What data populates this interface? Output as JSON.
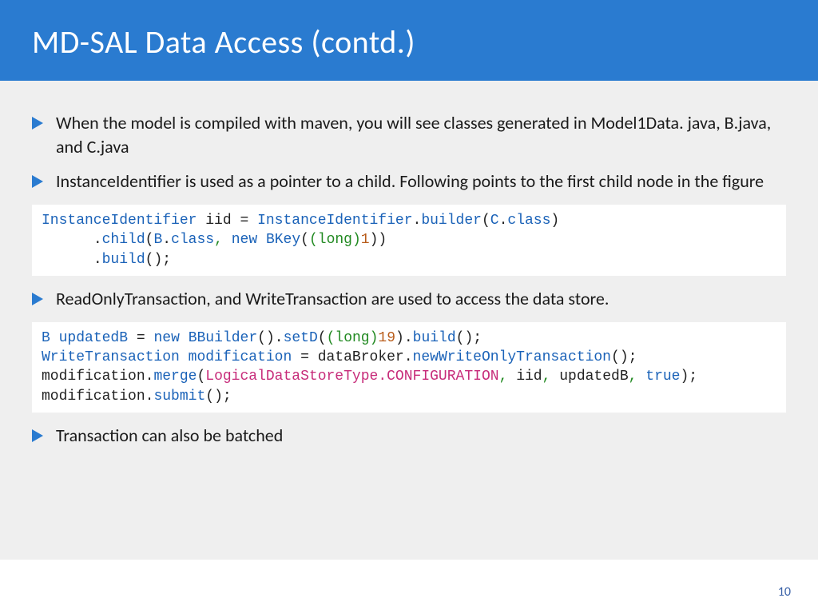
{
  "header": {
    "title": "MD-SAL Data Access (contd.)"
  },
  "bullets": {
    "b1": "When the model is compiled with maven, you will see classes generated in Model1Data. java, B.java, and C.java",
    "b2": "InstanceIdentifier is used as a pointer to a child. Following points to the first child node in the figure",
    "b3": "ReadOnlyTransaction, and WriteTransaction are used to access the data store.",
    "b4": "Transaction can also be batched"
  },
  "code1": {
    "l1": {
      "t1": "InstanceIdentifier",
      "sp1": " iid ",
      "eq": "=",
      "sp2": " ",
      "t2": "InstanceIdentifier",
      "dot1": ".",
      "m1": "builder",
      "open1": "(",
      "t3": "C",
      "dot2": ".",
      "cls1": "class",
      "close1": ")"
    },
    "l2": {
      "indent": "      ",
      "dot1": ".",
      "m1": "child",
      "open1": "(",
      "t1": "B",
      "dot2": ".",
      "cls1": "class",
      "comma1": ",",
      "sp1": " ",
      "new1": "new",
      "sp2": " ",
      "t2": "BKey",
      "open2": "(",
      "cast": "(long)",
      "num": "1",
      "close2": ")",
      "close1": ")"
    },
    "l3": {
      "indent": "      ",
      "dot1": ".",
      "m1": "build",
      "open1": "(",
      "close1": ")",
      "semi": ";"
    }
  },
  "code2": {
    "l1": {
      "t1": "B",
      "sp1": " ",
      "var1": "updatedB",
      "sp2": " ",
      "eq": "=",
      "sp3": " ",
      "new1": "new",
      "sp4": " ",
      "t2": "BBuilder",
      "open1": "(",
      "close1": ")",
      "dot1": ".",
      "m1": "setD",
      "open2": "(",
      "cast": "(long)",
      "num": "19",
      "close2": ")",
      "dot2": ".",
      "m2": "build",
      "open3": "(",
      "close3": ")",
      "semi": ";"
    },
    "l2": {
      "t1": "WriteTransaction",
      "sp1": " ",
      "var1": "modification",
      "sp2": " ",
      "eq": "=",
      "sp3": " ",
      "obj": "dataBroker",
      "dot1": ".",
      "m1": "newWriteOnlyTransaction",
      "open1": "(",
      "close1": ")",
      "semi": ";"
    },
    "l3": {
      "var1": "modification",
      "dot1": ".",
      "m1": "merge",
      "open1": "(",
      "enum1": "LogicalDataStoreType",
      "dot2": ".",
      "enum2": "CONFIGURATION",
      "comma1": ",",
      "sp1": " ",
      "arg2": "iid",
      "comma2": ",",
      "sp2": " ",
      "arg3": "updatedB",
      "comma3": ",",
      "sp3": " ",
      "bool": "true",
      "close1": ")",
      "semi": ";"
    },
    "l4": {
      "var1": "modification",
      "dot1": ".",
      "m1": "submit",
      "open1": "(",
      "close1": ")",
      "semi": ";"
    }
  },
  "page_number": "10"
}
